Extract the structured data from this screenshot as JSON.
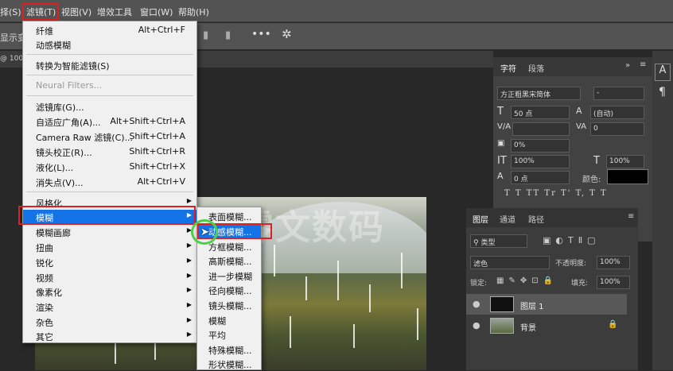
{
  "menubar": {
    "items": [
      "择(S)",
      "滤镜(T)",
      "视图(V)",
      "增效工具",
      "窗口(W)",
      "帮助(H)"
    ]
  },
  "options": {
    "left_text": "显示变",
    "zoom_text": "@ 100%"
  },
  "filter_menu": {
    "last_filter": "纤维",
    "last_filter_shortcut": "Alt+Ctrl+F",
    "motion_blur": "动感模糊",
    "convert_smart": "转换为智能滤镜(S)",
    "neural": "Neural Filters...",
    "gallery": "滤镜库(G)...",
    "adaptive": "自适应广角(A)...",
    "adaptive_sc": "Alt+Shift+Ctrl+A",
    "camera_raw": "Camera Raw 滤镜(C)...",
    "camera_raw_sc": "Shift+Ctrl+A",
    "lens": "镜头校正(R)...",
    "lens_sc": "Shift+Ctrl+R",
    "liquify": "液化(L)...",
    "liquify_sc": "Shift+Ctrl+X",
    "vanish": "消失点(V)...",
    "vanish_sc": "Alt+Ctrl+V",
    "submenus": [
      "风格化",
      "模糊",
      "模糊画廊",
      "扭曲",
      "锐化",
      "视频",
      "像素化",
      "渲染",
      "杂色",
      "其它"
    ]
  },
  "blur_menu": {
    "items": [
      "表面模糊...",
      "动感模糊...",
      "方框模糊...",
      "高斯模糊...",
      "进一步模糊",
      "径向模糊...",
      "镜头模糊...",
      "模糊",
      "平均",
      "特殊模糊...",
      "形状模糊..."
    ]
  },
  "char_panel": {
    "tab1": "字符",
    "tab2": "段落",
    "font": "方正粗黑宋简体",
    "style": "-",
    "size": "50 点",
    "leading": "(自动)",
    "kerning": "",
    "tracking": "0",
    "tsume": "0%",
    "vscale": "100%",
    "hscale": "100%",
    "baseline": "0 点",
    "color_label": "颜色:",
    "tt_row": "T T TT Tr T' T, T T",
    "color_hex": "#000000"
  },
  "layers_panel": {
    "tab1": "图层",
    "tab2": "通道",
    "tab3": "路径",
    "kind": "类型",
    "blend": "滤色",
    "opacity_label": "不透明度:",
    "opacity": "100%",
    "lock_label": "锁定:",
    "fill_label": "填充:",
    "fill": "100%",
    "layers": [
      {
        "name": "图层 1"
      },
      {
        "name": "背景"
      }
    ]
  },
  "watermark": "零文数码"
}
